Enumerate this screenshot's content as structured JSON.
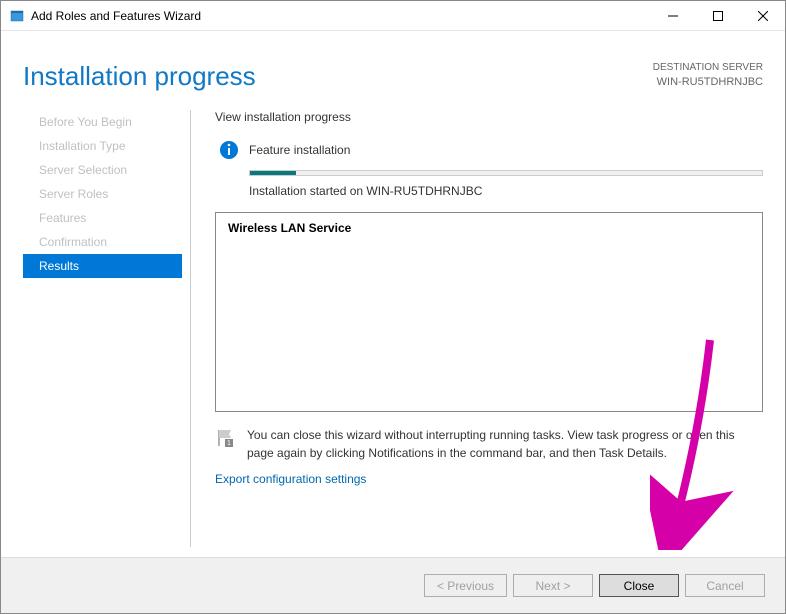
{
  "titlebar": {
    "title": "Add Roles and Features Wizard"
  },
  "header": {
    "page_title": "Installation progress",
    "dest_label": "DESTINATION SERVER",
    "dest_name": "WIN-RU5TDHRNJBC"
  },
  "sidebar": {
    "items": [
      {
        "label": "Before You Begin"
      },
      {
        "label": "Installation Type"
      },
      {
        "label": "Server Selection"
      },
      {
        "label": "Server Roles"
      },
      {
        "label": "Features"
      },
      {
        "label": "Confirmation"
      },
      {
        "label": "Results"
      }
    ]
  },
  "content": {
    "header": "View installation progress",
    "status": "Feature installation",
    "install_status": "Installation started on WIN-RU5TDHRNJBC",
    "feature": "Wireless LAN Service",
    "footer_note": "You can close this wizard without interrupting running tasks. View task progress or open this page again by clicking Notifications in the command bar, and then Task Details.",
    "export_link": "Export configuration settings"
  },
  "buttons": {
    "previous": "< Previous",
    "next": "Next >",
    "close": "Close",
    "cancel": "Cancel"
  }
}
